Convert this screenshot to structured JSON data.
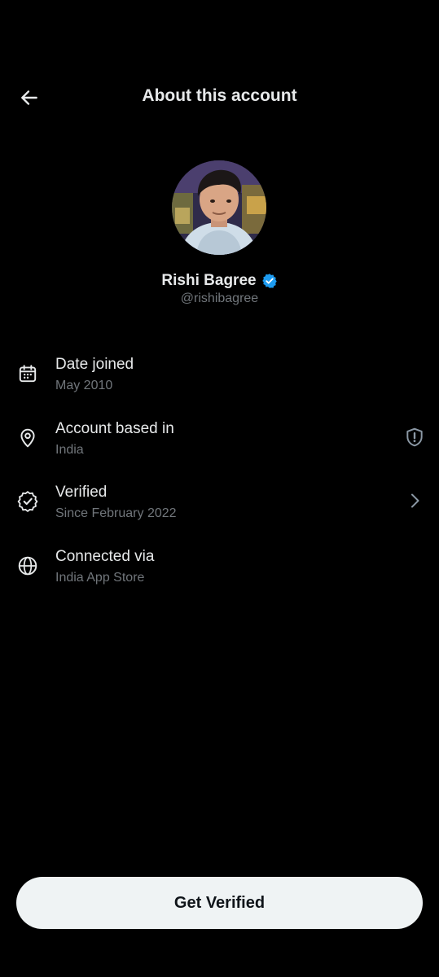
{
  "header": {
    "title": "About this account",
    "back_icon": "arrow-left-icon"
  },
  "profile": {
    "name": "Rishi Bagree",
    "handle": "@rishibagree",
    "verified_badge_color": "#1d9bf0",
    "avatar_icon": "profile-photo"
  },
  "info": {
    "items": [
      {
        "title": "Date joined",
        "subtitle": "May 2010",
        "icon": "calendar-icon"
      },
      {
        "title": "Account based in",
        "subtitle": "India",
        "icon": "location-pin-icon",
        "trailing_icon": "shield-alert-icon"
      },
      {
        "title": "Verified",
        "subtitle": "Since February 2022",
        "icon": "verified-check-icon",
        "trailing_icon": "chevron-right-icon"
      },
      {
        "title": "Connected via",
        "subtitle": "India App Store",
        "icon": "globe-icon"
      }
    ]
  },
  "footer": {
    "get_verified_label": "Get Verified"
  },
  "colors": {
    "background": "#000000",
    "primary_text": "#e7e9ea",
    "secondary_text": "#71767b",
    "button_background": "#eff3f4",
    "button_text": "#0f1419",
    "accent": "#1d9bf0"
  }
}
